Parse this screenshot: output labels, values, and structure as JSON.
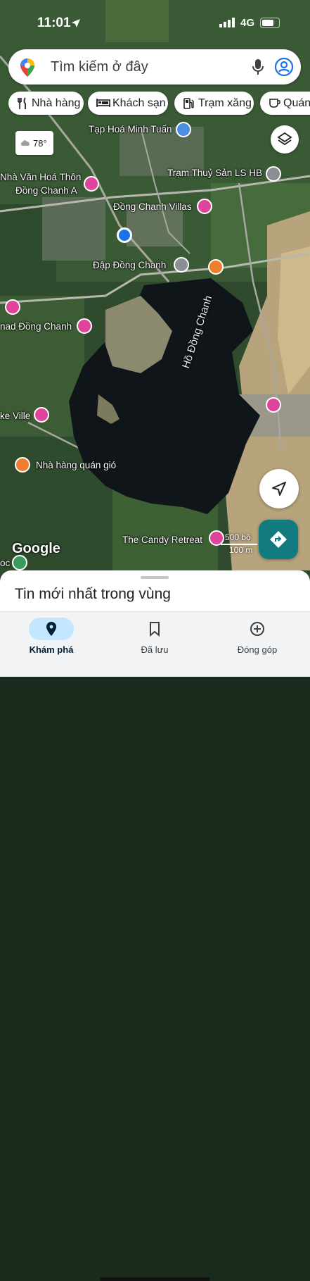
{
  "status": {
    "time": "11:01",
    "network": "4G"
  },
  "search": {
    "placeholder": "Tìm kiếm ở đây"
  },
  "chips": [
    {
      "label": "Nhà hàng",
      "icon": "restaurant-icon"
    },
    {
      "label": "Khách sạn",
      "icon": "hotel-icon"
    },
    {
      "label": "Trạm xăng",
      "icon": "gas-station-icon"
    },
    {
      "label": "Quán",
      "icon": "coffee-icon"
    }
  ],
  "weather": {
    "temp": "78°"
  },
  "map": {
    "places": {
      "tap_hoa": "Tạp Hoá Minh Tuấn",
      "nha_van_hoa_1": "Nhà Văn Hoá Thôn",
      "nha_van_hoa_2": "Đồng Chanh A",
      "tram_thuy_san": "Trạm Thuỷ Sản LS HB",
      "villas": "Đồng Chanh Villas",
      "dap": "Đập Đồng Chanh",
      "nomad": "nad Đồng Chanh",
      "lake": "Hồ Đồng Chanh",
      "ke_ville": "ke Ville",
      "restaurant": "Nhà hàng quán gió",
      "candy": "The Candy Retreat",
      "oc": "oc"
    },
    "attribution": "Google",
    "scale": {
      "imperial": "500 bộ",
      "metric": "100 m"
    }
  },
  "sheet": {
    "title": "Tin mới nhất trong vùng"
  },
  "nav": [
    {
      "label": "Khám phá",
      "icon": "explore-pin-icon",
      "active": true
    },
    {
      "label": "Đã lưu",
      "icon": "bookmark-icon",
      "active": false
    },
    {
      "label": "Đóng góp",
      "icon": "add-circle-icon",
      "active": false
    }
  ],
  "colors": {
    "accent": "#1a73e8",
    "poi_pink": "#e0439c",
    "poi_orange": "#ef7d2e",
    "directions": "#127b7f",
    "nav_active": "#c2e7ff"
  }
}
